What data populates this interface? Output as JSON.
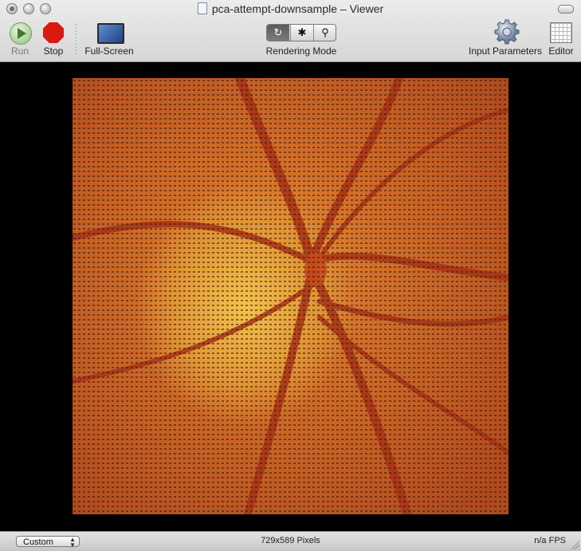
{
  "window": {
    "title": "pca-attempt-downsample – Viewer"
  },
  "toolbar": {
    "run_label": "Run",
    "stop_label": "Stop",
    "fullscreen_label": "Full-Screen",
    "rendering_mode_label": "Rendering Mode",
    "rendering_modes": [
      "refresh-icon",
      "bug-icon",
      "magnifier-icon"
    ],
    "input_parameters_label": "Input Parameters",
    "editor_label": "Editor"
  },
  "statusbar": {
    "size_popup_value": "Custom",
    "dimensions_text": "729x589 Pixels",
    "fps_text": "n/a FPS"
  },
  "colors": {
    "image_background": "#000000",
    "stop_red": "#d91a12",
    "run_green": "#8fc07a"
  }
}
